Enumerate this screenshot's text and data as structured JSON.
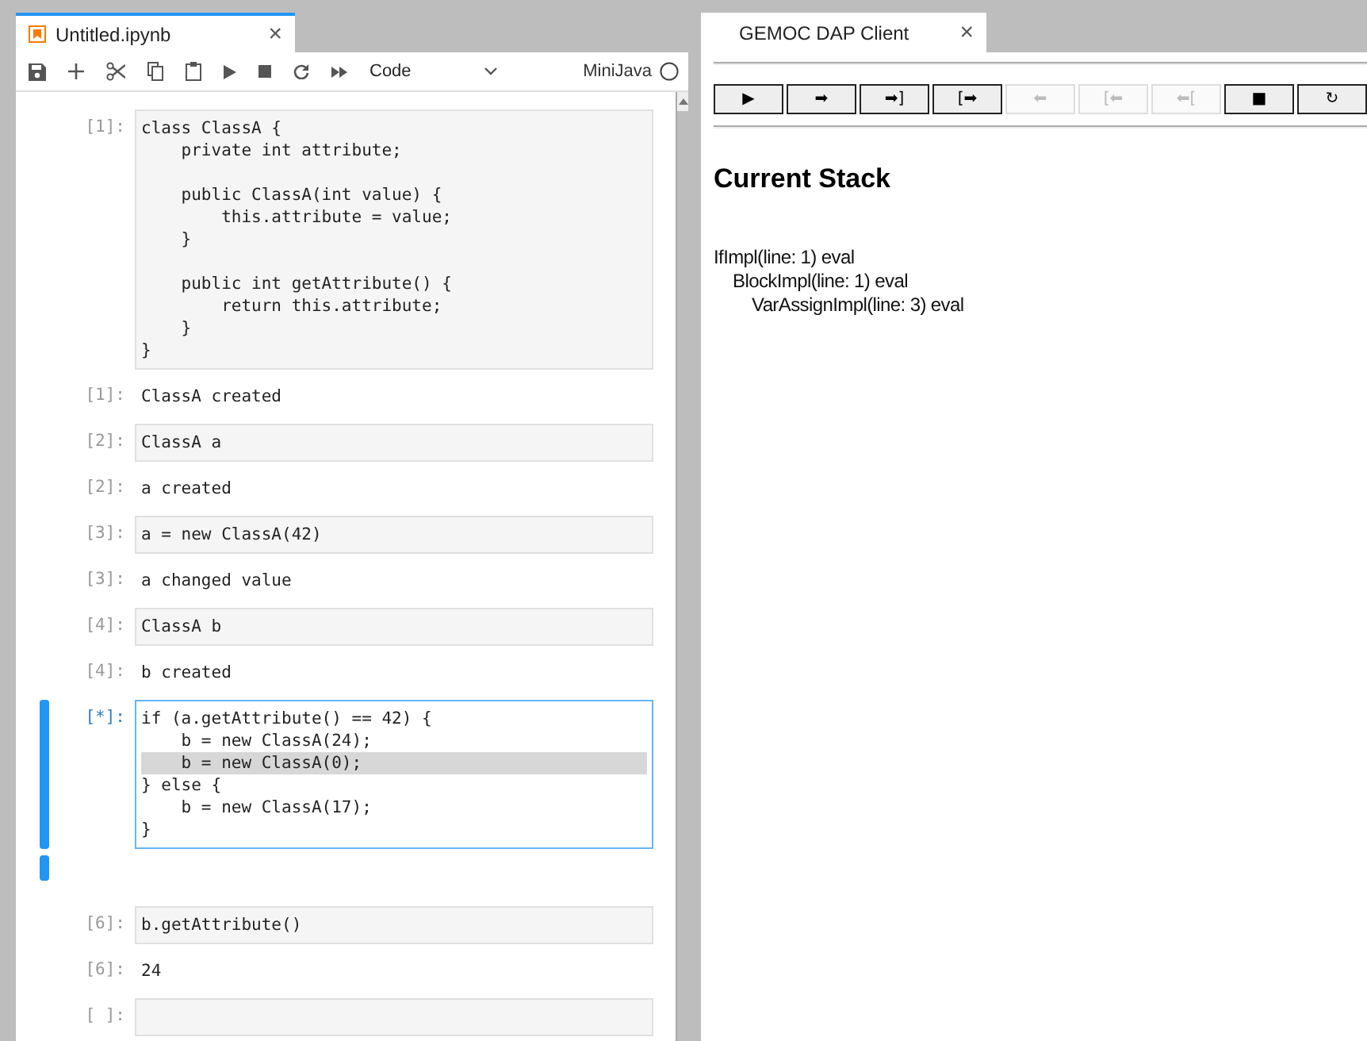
{
  "notebook": {
    "tab": {
      "title": "Untitled.ipynb",
      "close": "×",
      "selected": true
    },
    "toolbar": {
      "cell_type": "Code",
      "kernel": "MiniJava"
    },
    "cells": [
      {
        "prompt": "[1]:",
        "selected": false,
        "lines": [
          {
            "text": "class ClassA {",
            "highlighted": false
          },
          {
            "text": "    private int attribute;",
            "highlighted": false
          },
          {
            "highlighted": false
          },
          {
            "text": "    public ClassA(int value) {",
            "highlighted": false
          },
          {
            "text": "        this.attribute = value;",
            "highlighted": false
          },
          {
            "text": "    }",
            "highlighted": false
          },
          {
            "highlighted": false
          },
          {
            "text": "    public int getAttribute() {",
            "highlighted": false
          },
          {
            "text": "        return this.attribute;",
            "highlighted": false
          },
          {
            "text": "    }",
            "highlighted": false
          },
          {
            "text": "}",
            "highlighted": false
          }
        ],
        "output": {
          "prompt": "[1]:",
          "text": "ClassA created"
        }
      },
      {
        "prompt": "[2]:",
        "selected": false,
        "lines": [
          {
            "text": "ClassA a",
            "highlighted": false
          }
        ],
        "output": {
          "prompt": "[2]:",
          "text": "a created"
        }
      },
      {
        "prompt": "[3]:",
        "selected": false,
        "lines": [
          {
            "text": "a = new ClassA(42)",
            "highlighted": false
          }
        ],
        "output": {
          "prompt": "[3]:",
          "text": "a changed value"
        }
      },
      {
        "prompt": "[4]:",
        "selected": false,
        "lines": [
          {
            "text": "ClassA b",
            "highlighted": false
          }
        ],
        "output": {
          "prompt": "[4]:",
          "text": "b created"
        }
      },
      {
        "prompt": "[*]:",
        "selected": true,
        "lines": [
          {
            "text": "if (a.getAttribute() == 42) {",
            "highlighted": false
          },
          {
            "text": "    b = new ClassA(24);",
            "highlighted": false
          },
          {
            "text": "    b = new ClassA(0);",
            "highlighted": true
          },
          {
            "text": "} else {",
            "highlighted": false
          },
          {
            "text": "    b = new ClassA(17);",
            "highlighted": false
          },
          {
            "text": "}",
            "highlighted": false
          }
        ]
      },
      {
        "prompt": "[6]:",
        "selected": false,
        "lines": [
          {
            "text": "b.getAttribute()",
            "highlighted": false
          }
        ],
        "output": {
          "prompt": "[6]:",
          "text": "24"
        }
      },
      {
        "prompt": "[ ]:",
        "selected": false
      }
    ]
  },
  "debugger": {
    "tab": {
      "title": "GEMOC DAP Client",
      "close": "×",
      "selected": false
    },
    "buttons": [
      {
        "label": "▶",
        "disabled": false
      },
      {
        "label": "➡",
        "disabled": false
      },
      {
        "label": "➡]",
        "disabled": false
      },
      {
        "label": "[➡",
        "disabled": false
      },
      {
        "label": "⬅",
        "disabled": true
      },
      {
        "label": "[⬅",
        "disabled": true
      },
      {
        "label": "⬅[",
        "disabled": true
      },
      {
        "label": "■",
        "disabled": false
      },
      {
        "label": "↻",
        "disabled": false
      }
    ],
    "heading": "Current Stack",
    "stack": [
      {
        "label": "IfImpl(line: 1) eval",
        "children": [
          {
            "label": "BlockImpl(line: 1) eval",
            "children": [
              {
                "label": "VarAssignImpl(line: 3) eval"
              }
            ]
          }
        ]
      }
    ]
  }
}
